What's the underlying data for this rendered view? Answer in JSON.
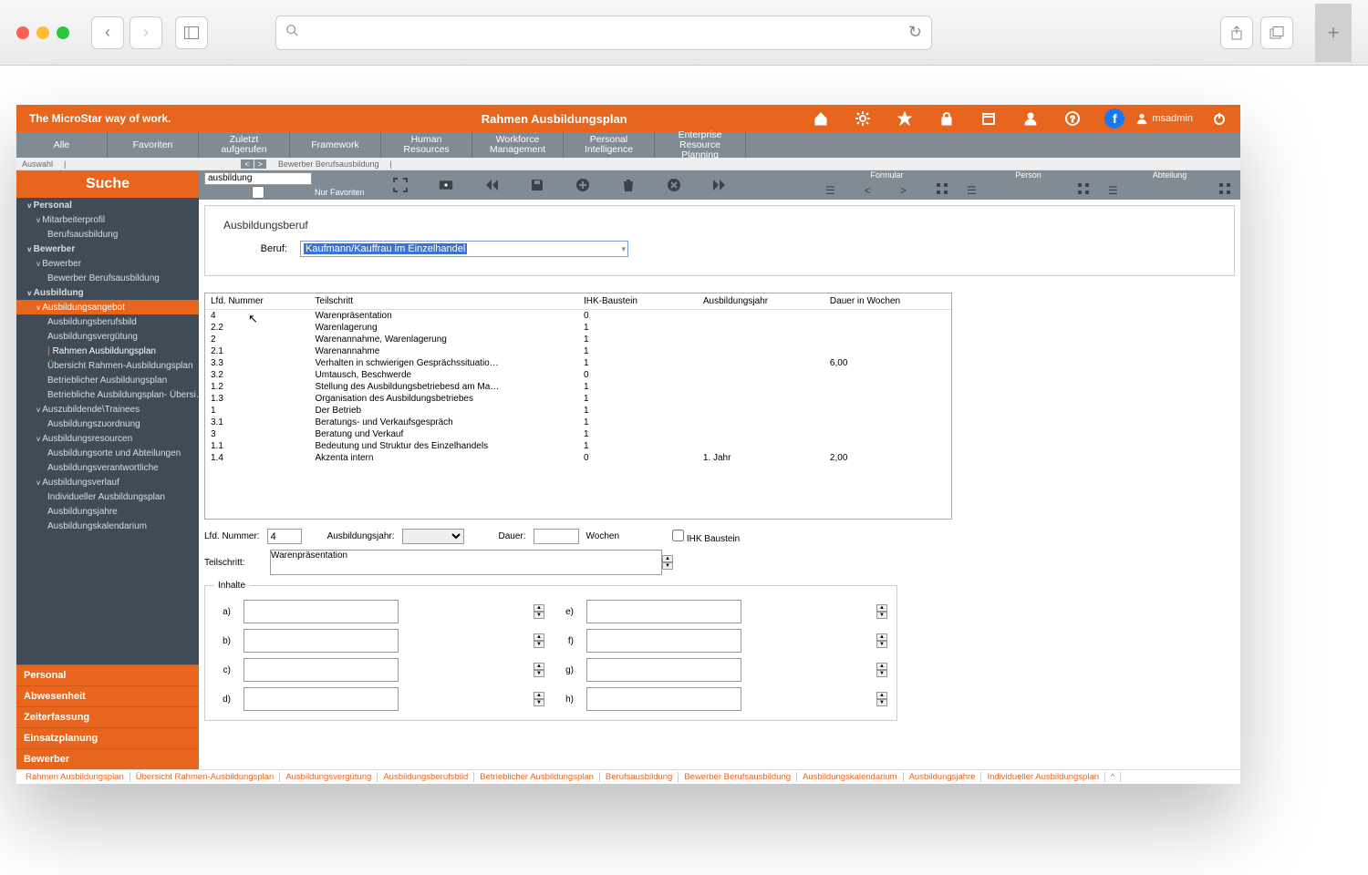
{
  "chrome": {
    "search_placeholder": ""
  },
  "header": {
    "tagline": "The MicroStar way of work.",
    "title": "Rahmen Ausbildungsplan",
    "user": "msadmin"
  },
  "nav_tabs": [
    "Alle",
    "Favoriten",
    "Zuletzt aufgerufen",
    "Framework",
    "Human Resources",
    "Workforce Management",
    "Personal Intelligence",
    "Enterprise Resource Planning"
  ],
  "breadcrumb": {
    "auswahl": "Auswahl",
    "current": "Bewerber Berufsausbildung"
  },
  "sidebar": {
    "title": "Suche",
    "tree": [
      {
        "l": 1,
        "t": "Personal",
        "c": 1
      },
      {
        "l": 2,
        "t": "Mitarbeiterprofil",
        "c": 1
      },
      {
        "l": 3,
        "t": "Berufsausbildung"
      },
      {
        "l": 1,
        "t": "Bewerber",
        "c": 1
      },
      {
        "l": 2,
        "t": "Bewerber",
        "c": 1
      },
      {
        "l": 3,
        "t": "Bewerber Berufsausbildung"
      },
      {
        "l": 1,
        "t": "Ausbildung",
        "c": 1
      },
      {
        "l": 2,
        "t": "Ausbildungsangebot",
        "active": 1,
        "c": 1
      },
      {
        "l": 3,
        "t": "Ausbildungsberufsbild"
      },
      {
        "l": 3,
        "t": "Ausbildungsvergütung"
      },
      {
        "l": 3,
        "t": "Rahmen Ausbildungsplan",
        "cur": 1
      },
      {
        "l": 3,
        "t": "Übersicht Rahmen-Ausbildungsplan"
      },
      {
        "l": 3,
        "t": "Betrieblicher Ausbildungsplan"
      },
      {
        "l": 3,
        "t": "Betriebliche Ausbildungsplan- Übersi…"
      },
      {
        "l": 2,
        "t": "Auszubildende\\Trainees",
        "c": 1
      },
      {
        "l": 3,
        "t": "Ausbildungszuordnung"
      },
      {
        "l": 2,
        "t": "Ausbildungsresourcen",
        "c": 1
      },
      {
        "l": 3,
        "t": "Ausbildungsorte und Abteilungen"
      },
      {
        "l": 3,
        "t": "Ausbildungsverantwortliche"
      },
      {
        "l": 2,
        "t": "Ausbildungsverlauf",
        "c": 1
      },
      {
        "l": 3,
        "t": "Individueller Ausbildungsplan"
      },
      {
        "l": 3,
        "t": "Ausbildungsjahre"
      },
      {
        "l": 3,
        "t": "Ausbildungskalendarium"
      }
    ],
    "bottom_tabs": [
      "Personal",
      "Abwesenheit",
      "Zeiterfassung",
      "Einsatzplanung",
      "Bewerber"
    ]
  },
  "toolbar": {
    "search_value": "ausbildung",
    "fav_label": "Nur Favoriten",
    "sections": [
      "Formular",
      "Person",
      "Abteilung"
    ]
  },
  "form": {
    "section_title": "Ausbildungsberuf",
    "beruf_label": "Beruf:",
    "beruf_value": "Kaufmann/Kauffrau im Einzelhandel"
  },
  "grid": {
    "headers": [
      "Lfd. Nummer",
      "Teilschritt",
      "IHK-Baustein",
      "Ausbildungsjahr",
      "Dauer in Wochen"
    ],
    "rows": [
      [
        "4",
        "Warenpräsentation",
        "0",
        "",
        ""
      ],
      [
        "2.2",
        "Warenlagerung",
        "1",
        "",
        ""
      ],
      [
        "2",
        "Warenannahme, Warenlagerung",
        "1",
        "",
        ""
      ],
      [
        "2.1",
        "Warenannahme",
        "1",
        "",
        ""
      ],
      [
        "3.3",
        "Verhalten in schwierigen Gesprächssituatio…",
        "1",
        "",
        "6,00"
      ],
      [
        "3.2",
        "Umtausch, Beschwerde",
        "0",
        "",
        ""
      ],
      [
        "1.2",
        "Stellung des Ausbildungsbetriebesd am Ma…",
        "1",
        "",
        ""
      ],
      [
        "1.3",
        "Organisation des Ausbildungsbetriebes",
        "1",
        "",
        ""
      ],
      [
        "1",
        "Der Betrieb",
        "1",
        "",
        ""
      ],
      [
        "3.1",
        "Beratungs- und Verkaufsgespräch",
        "1",
        "",
        ""
      ],
      [
        "3",
        "Beratung und Verkauf",
        "1",
        "",
        ""
      ],
      [
        "1.1",
        "Bedeutung und Struktur des Einzelhandels",
        "1",
        "",
        ""
      ],
      [
        "1.4",
        "Akzenta intern",
        "0",
        "1. Jahr",
        "2,00"
      ]
    ]
  },
  "detail": {
    "lfd_label": "Lfd. Nummer:",
    "lfd_value": "4",
    "jahr_label": "Ausbildungsjahr:",
    "jahr_value": "",
    "dauer_label": "Dauer:",
    "dauer_value": "",
    "wochen_label": "Wochen",
    "ihk_label": "IHK Baustein",
    "teil_label": "Teilschritt:",
    "teil_value": "Warenpräsentation",
    "inhalte_label": "Inhalte",
    "labels": [
      "a)",
      "b)",
      "c)",
      "d)",
      "e)",
      "f)",
      "g)",
      "h)"
    ]
  },
  "bottom_links": [
    "Rahmen Ausbildungsplan",
    "Übersicht Rahmen-Ausbildungsplan",
    "Ausbildungsvergütung",
    "Ausbildungsberufsbild",
    "Betrieblicher Ausbildungsplan",
    "Berufsausbildung",
    "Bewerber Berufsausbildung",
    "Ausbildungskalendarium",
    "Ausbildungsjahre",
    "Individueller Ausbildungsplan",
    "^"
  ]
}
